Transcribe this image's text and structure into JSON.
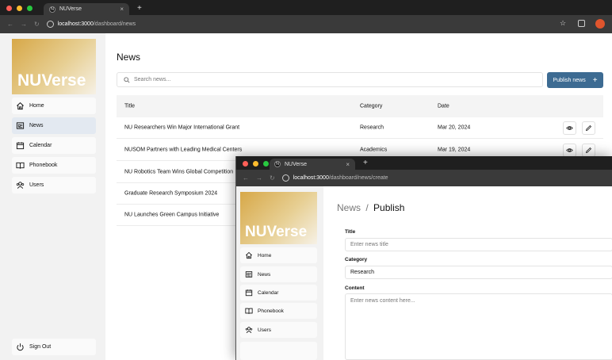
{
  "window_main": {
    "tab_title": "NUVerse",
    "url_host": "localhost:3000",
    "url_path": "/dashboard/news",
    "logo_text": "NUVerse",
    "nav": [
      {
        "label": "Home"
      },
      {
        "label": "News"
      },
      {
        "label": "Calendar"
      },
      {
        "label": "Phonebook"
      },
      {
        "label": "Users"
      }
    ],
    "signout_label": "Sign Out",
    "page_title": "News",
    "search_placeholder": "Search news...",
    "publish_label": "Publish news",
    "publish_plus": "+",
    "table": {
      "columns": [
        "Title",
        "Category",
        "Date"
      ],
      "rows": [
        {
          "title": "NU Researchers Win Major International Grant",
          "category": "Research",
          "date": "Mar 20, 2024"
        },
        {
          "title": "NUSOM Partners with Leading Medical Centers",
          "category": "Academics",
          "date": "Mar 19, 2024"
        },
        {
          "title": "NU Robotics Team Wins Global Competition",
          "category": "",
          "date": ""
        },
        {
          "title": "Graduate Research Symposium 2024",
          "category": "",
          "date": ""
        },
        {
          "title": "NU Launches Green Campus Initiative",
          "category": "",
          "date": ""
        }
      ]
    }
  },
  "window_create": {
    "tab_title": "NUVerse",
    "url_host": "localhost:3000",
    "url_path": "/dashboard/news/create",
    "logo_text": "NUVerse",
    "nav": [
      {
        "label": "Home"
      },
      {
        "label": "News"
      },
      {
        "label": "Calendar"
      },
      {
        "label": "Phonebook"
      },
      {
        "label": "Users"
      }
    ],
    "breadcrumb_parent": "News",
    "breadcrumb_sep": "/",
    "breadcrumb_current": "Publish",
    "form": {
      "title_label": "Title",
      "title_placeholder": "Enter news title",
      "category_label": "Category",
      "category_value": "Research",
      "content_label": "Content",
      "content_placeholder": "Enter news content here..."
    }
  },
  "colors": {
    "accent": "#3d6b92",
    "logo_gold": "#d7a848",
    "active_nav": "#e3e9f1",
    "chrome_dark": "#1f1f1f"
  },
  "icons": [
    "home-icon",
    "news-icon",
    "calendar-icon",
    "book-icon",
    "users-icon",
    "power-icon",
    "eye-icon",
    "pencil-icon",
    "search-icon",
    "star-icon",
    "extension-icon",
    "profile-icon"
  ]
}
